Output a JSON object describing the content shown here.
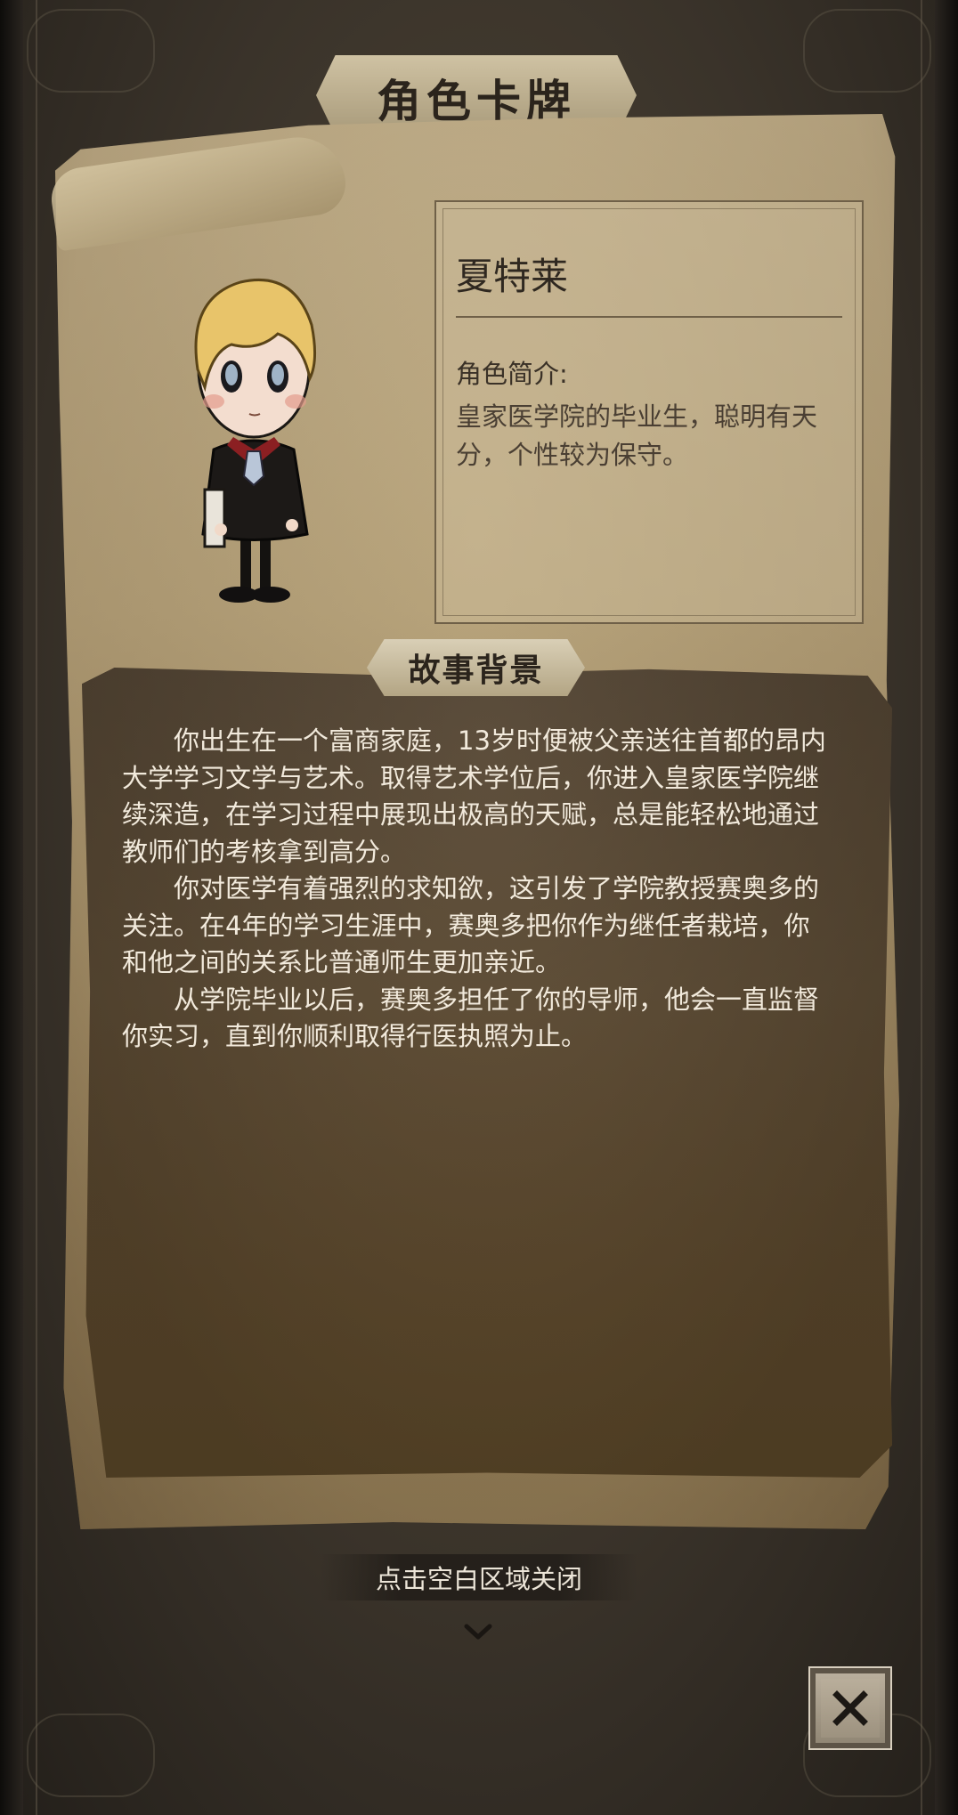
{
  "header": {
    "title": "角色卡牌"
  },
  "character": {
    "name": "夏特莱",
    "intro_label": "角色简介:",
    "intro_text": "皇家医学院的毕业生，聪明有天分，个性较为保守。"
  },
  "story": {
    "section_title": "故事背景",
    "paragraphs": [
      "你出生在一个富商家庭，13岁时便被父亲送往首都的昂内大学学习文学与艺术。取得艺术学位后，你进入皇家医学院继续深造，在学习过程中展现出极高的天赋，总是能轻松地通过教师们的考核拿到高分。",
      "你对医学有着强烈的求知欲，这引发了学院教授赛奥多的关注。在4年的学习生涯中，赛奥多把你作为继任者栽培，你和他之间的关系比普通师生更加亲近。",
      "从学院毕业以后，赛奥多担任了你的导师，他会一直监督你实习，直到你顺利取得行医执照为止。"
    ]
  },
  "footer": {
    "close_hint": "点击空白区域关闭",
    "chevron_icon": "chevron-down-icon",
    "close_icon": "close-icon"
  }
}
